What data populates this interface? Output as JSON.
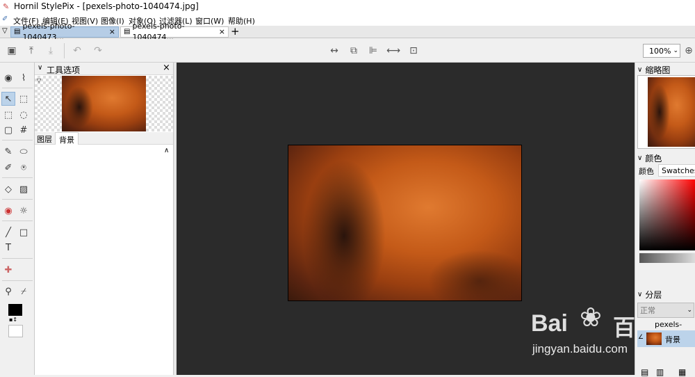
{
  "window": {
    "title": "Hornil StylePix - [pexels-photo-1040474.jpg]"
  },
  "menu": [
    "文件(F)",
    "编辑(E)",
    "视图(V)",
    "图像(I)",
    "对象(O)",
    "过滤器(L)",
    "窗口(W)",
    "帮助(H)"
  ],
  "tabs": [
    {
      "label": "pexels-photo-1040473...",
      "active": true
    },
    {
      "label": "pexels-photo-1040474...",
      "active": false
    }
  ],
  "toolbar": {
    "zoom_value": "100%"
  },
  "tool_options": {
    "title": "工具选项",
    "tabs": [
      "图层",
      "背景"
    ]
  },
  "right_panel": {
    "thumbnail_title": "缩略图",
    "color_title": "颜色",
    "color_tabs": [
      "颜色",
      "Swatches"
    ],
    "layers_title": "分层",
    "blend_mode": "正常",
    "layer_group_label": "pexels-pho",
    "layer_name": "背景"
  },
  "watermark": {
    "brand": "Bai",
    "brand2": "百",
    "url": "jingyan.baidu.com"
  },
  "colors": {
    "foreground": "#000000",
    "background": "#ffffff",
    "canvas_bg": "#2b2b2b",
    "accent": "#bcd3ea"
  }
}
